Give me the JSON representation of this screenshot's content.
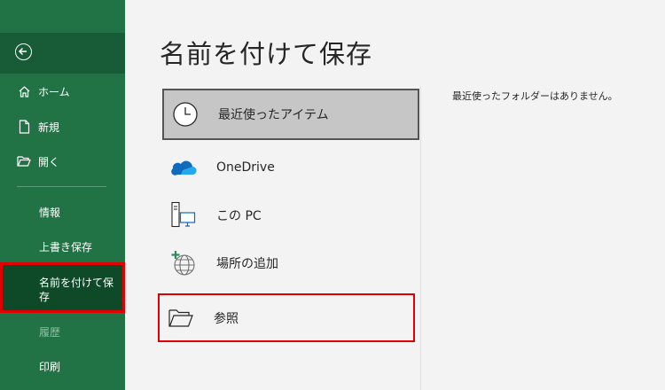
{
  "nav": {
    "items": [
      {
        "label": "ホーム",
        "icon": "home-icon"
      },
      {
        "label": "新規",
        "icon": "new-document-icon"
      },
      {
        "label": "開く",
        "icon": "open-folder-icon"
      },
      {
        "label": "情報"
      },
      {
        "label": "上書き保存"
      },
      {
        "label": "名前を付けて保存"
      },
      {
        "label": "履歴"
      },
      {
        "label": "印刷"
      }
    ]
  },
  "main": {
    "title": "名前を付けて保存",
    "locations": [
      {
        "label": "最近使ったアイテム",
        "icon": "clock-icon"
      },
      {
        "label": "OneDrive",
        "icon": "onedrive-cloud-icon"
      },
      {
        "label": "この PC",
        "icon": "computer-icon"
      },
      {
        "label": "場所の追加",
        "icon": "add-place-globe-icon"
      },
      {
        "label": "参照",
        "icon": "browse-folder-icon"
      }
    ],
    "empty_message": "最近使ったフォルダーはありません。"
  },
  "colors": {
    "nav_background": "#217346",
    "nav_selected": "#0e4a28",
    "highlight_border": "#e00000",
    "onedrive_blue": "#0f6cbd"
  }
}
